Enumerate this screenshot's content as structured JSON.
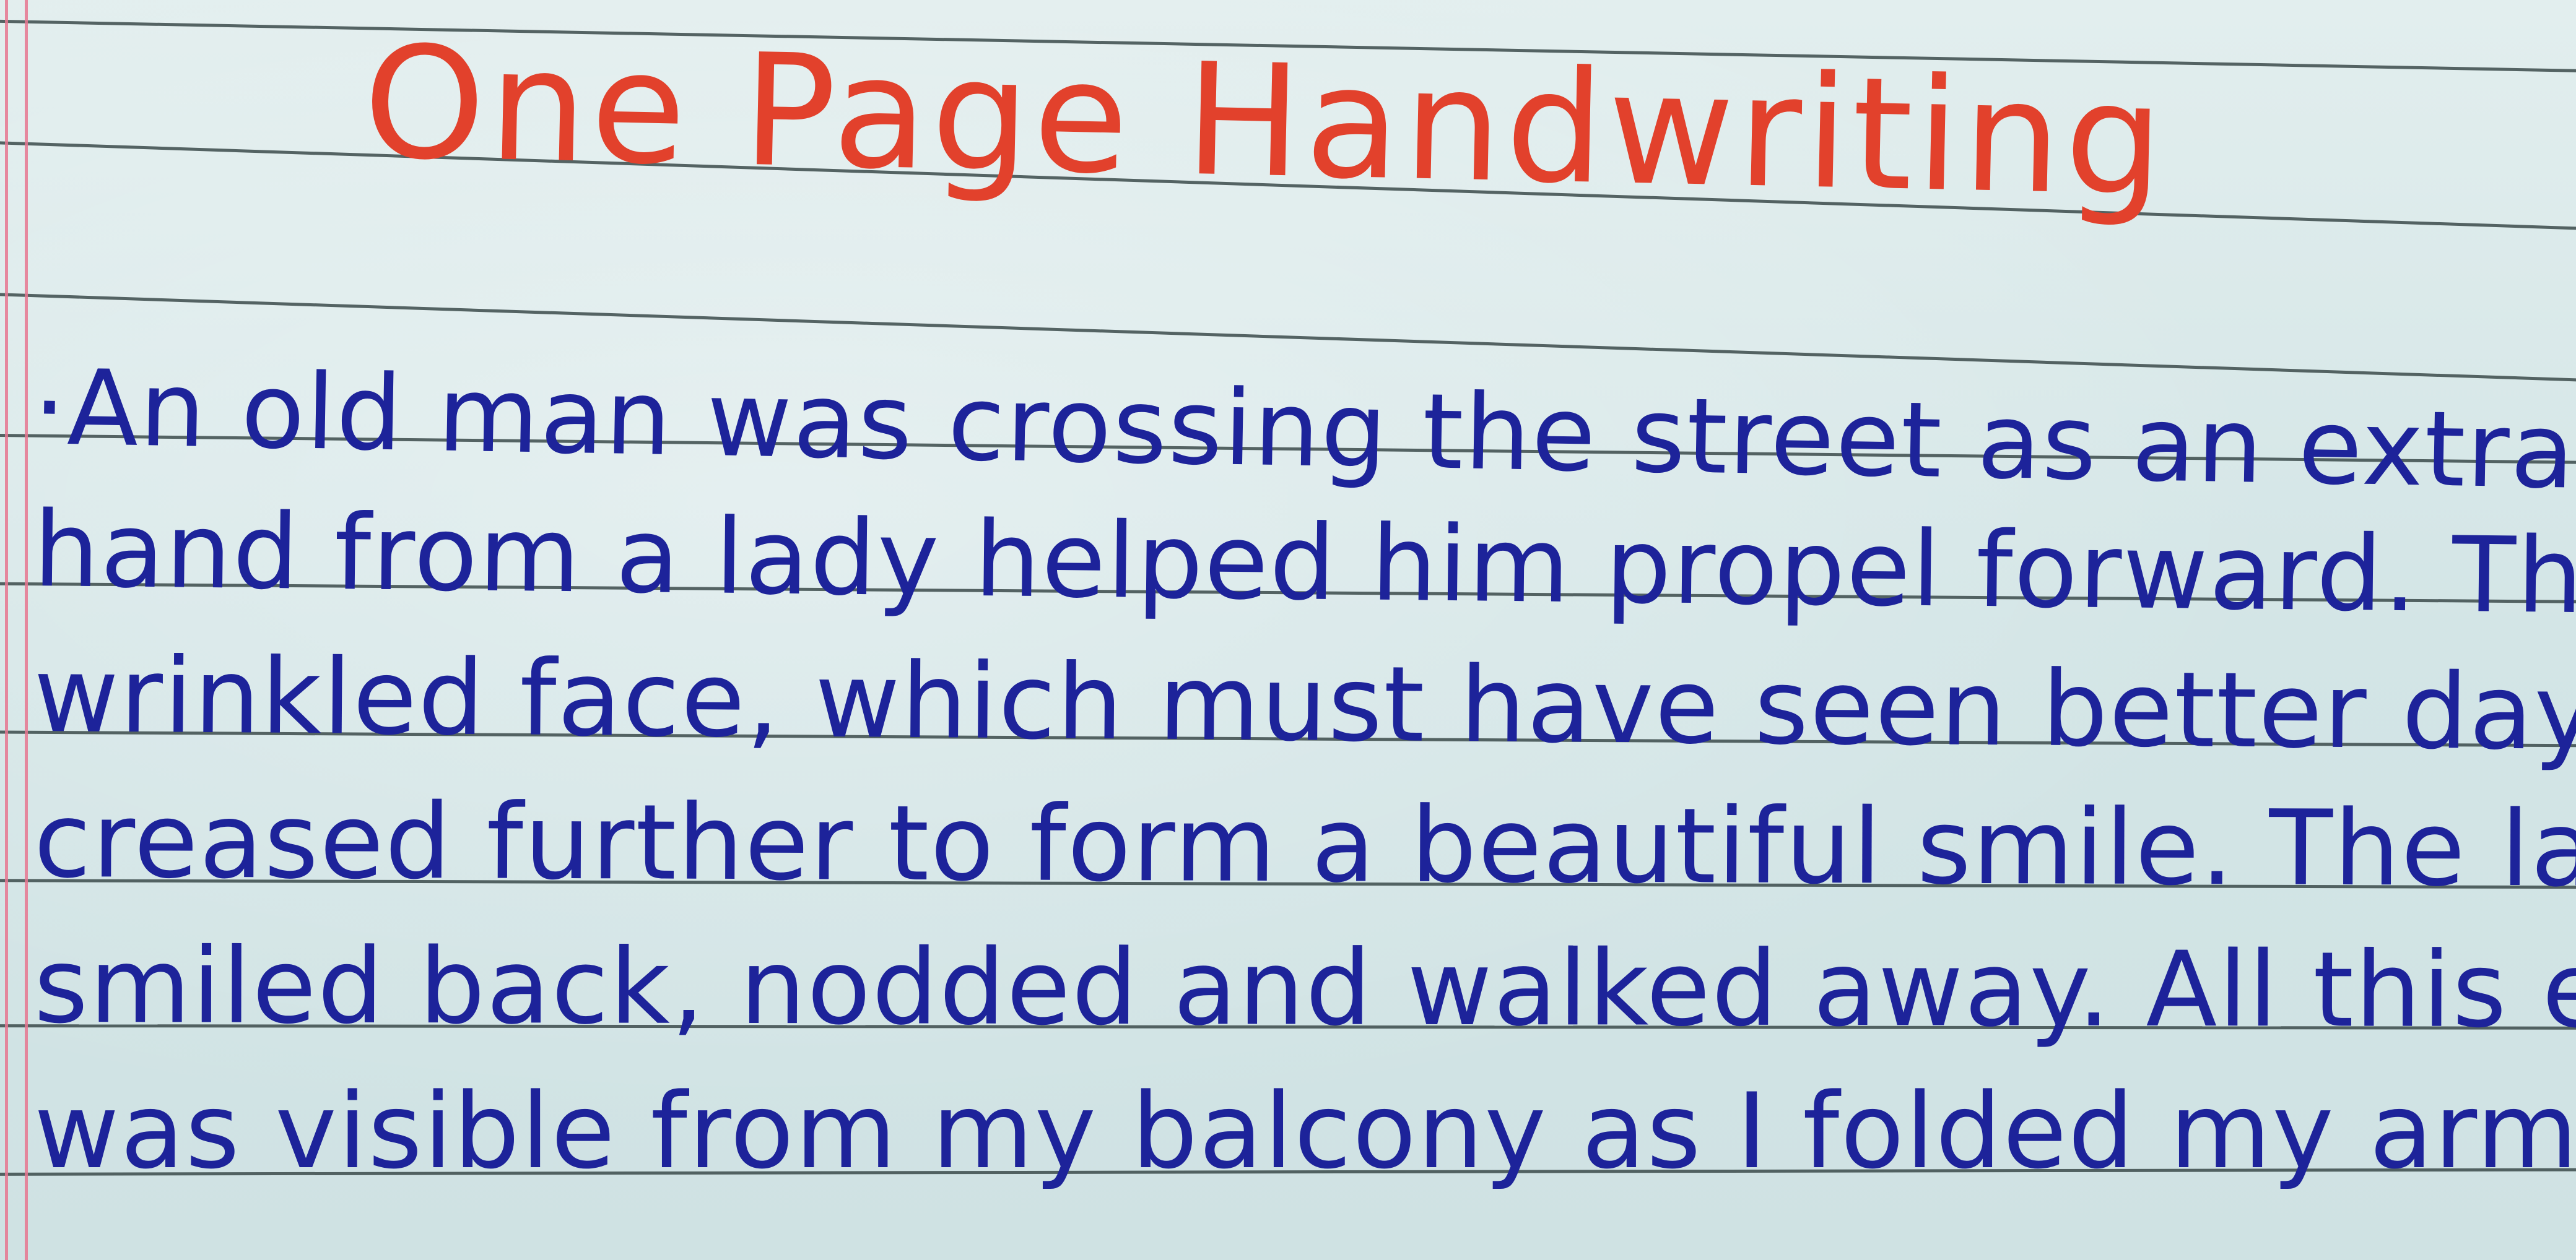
{
  "page": {
    "title": "One Page Handwriting",
    "lines": [
      "·An old man was crossing the street as an extra",
      "hand from a lady helped him propel forward. The",
      "wrinkled face, which must have seen better days,",
      "creased further to form a beautiful smile. The lady",
      "smiled back, nodded and walked away. All this episod",
      "was visible from my balcony as I folded my arms,"
    ]
  },
  "colors": {
    "paper": "#d5e6e7",
    "rule_lines": "#3b4a4a",
    "margin_line": "#e6758f",
    "title_ink": "#e2412c",
    "body_ink": "#1d239a"
  }
}
